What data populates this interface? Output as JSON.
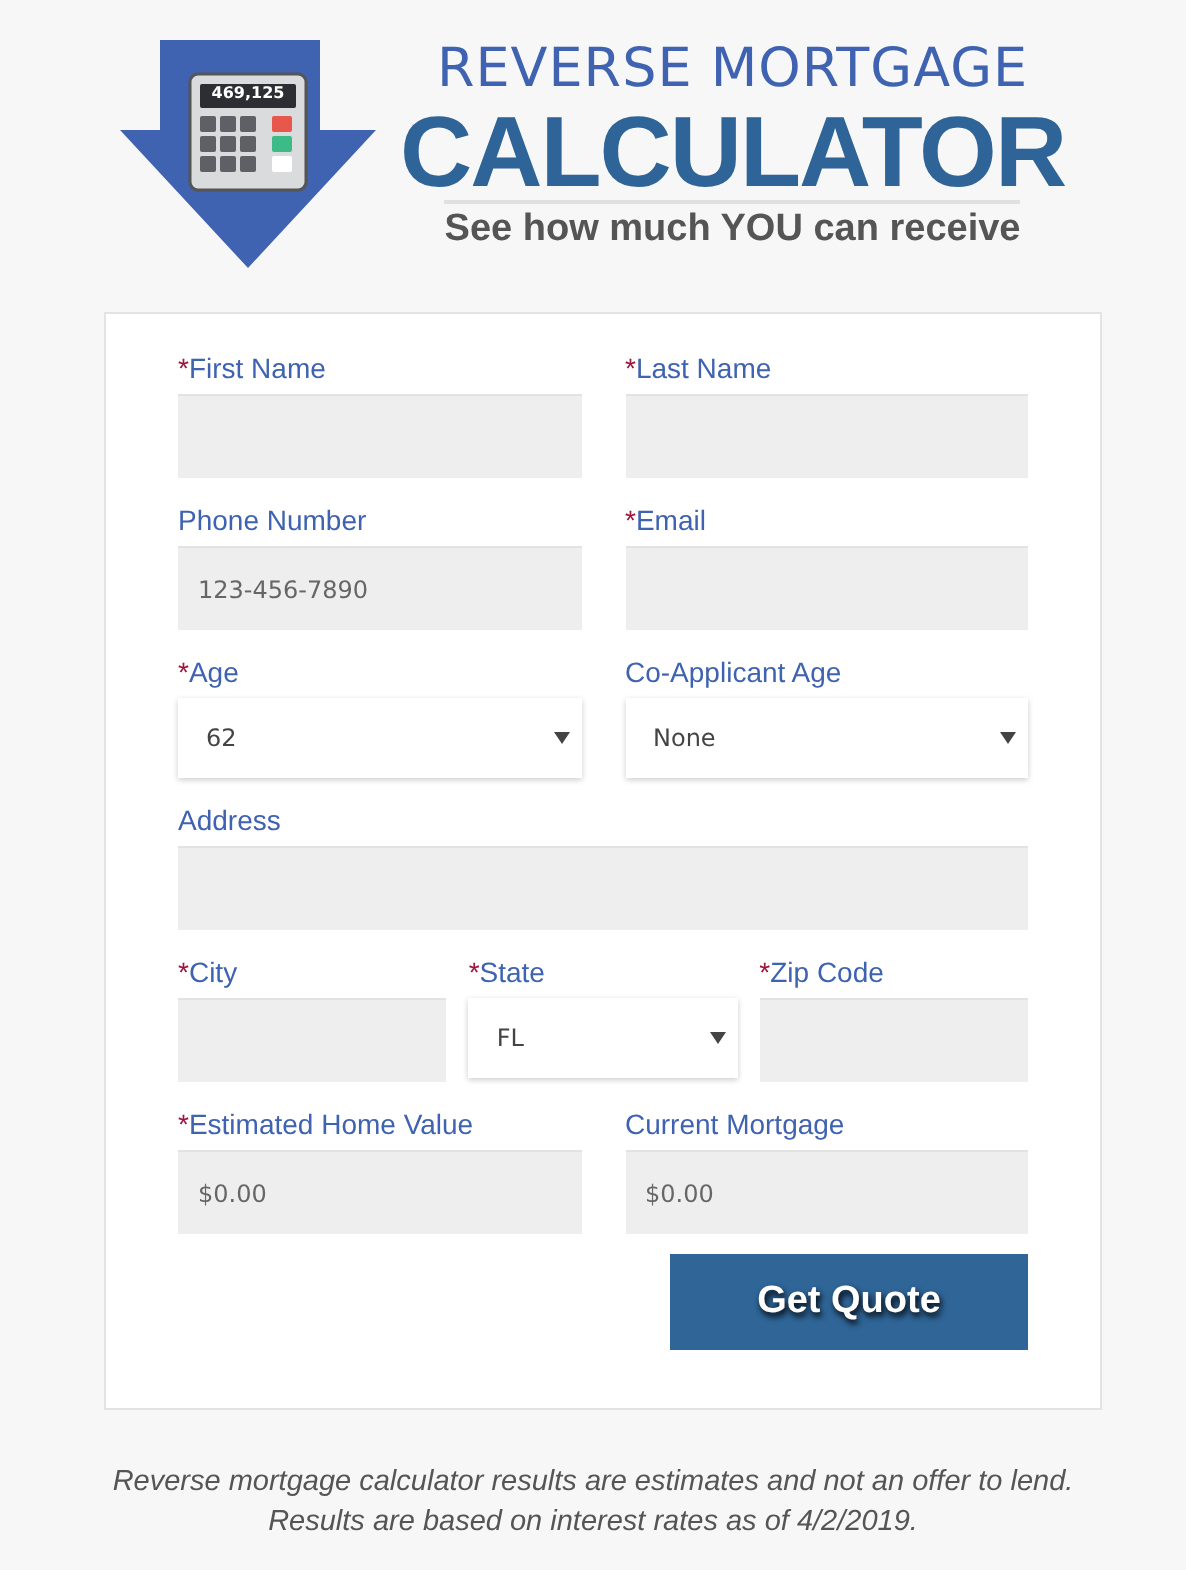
{
  "logo": {
    "display": "469,125",
    "title_top": "REVERSE MORTGAGE",
    "title_main": "CALCULATOR",
    "tagline": "See how much YOU can receive"
  },
  "form": {
    "rows": [
      {
        "fields": [
          {
            "kind": "text",
            "mark": "*",
            "label": "First Name"
          },
          {
            "kind": "text",
            "mark": "*",
            "label": "Last Name"
          }
        ]
      },
      {
        "fields": [
          {
            "kind": "text",
            "label": "Phone Number",
            "placeholder": "123-456-7890"
          },
          {
            "kind": "text",
            "mark": "*",
            "label": "Email"
          }
        ]
      },
      {
        "fields": [
          {
            "kind": "select",
            "mark": "*",
            "label": "Age",
            "value": "62"
          },
          {
            "kind": "select",
            "label": "Co-Applicant Age",
            "value": "None"
          }
        ]
      },
      {
        "fields": [
          {
            "kind": "text",
            "label": "Address"
          }
        ]
      },
      {
        "fields": [
          {
            "kind": "text",
            "mark": "*",
            "label": "City"
          },
          {
            "kind": "select",
            "mark": "*",
            "label": "State",
            "value": "FL"
          },
          {
            "kind": "text",
            "mark": "*",
            "label": "Zip Code"
          }
        ]
      },
      {
        "fields": [
          {
            "kind": "text",
            "mark": "*",
            "label": "Estimated Home Value",
            "placeholder": "$0.00"
          },
          {
            "kind": "text",
            "label": "Current Mortgage",
            "placeholder": "$0.00"
          }
        ]
      }
    ],
    "submit": "Get Quote"
  },
  "disclaimer": [
    "Reverse mortgage calculator results are estimates and not an offer to lend.",
    "Results are based on interest rates as of 4/2/2019."
  ]
}
